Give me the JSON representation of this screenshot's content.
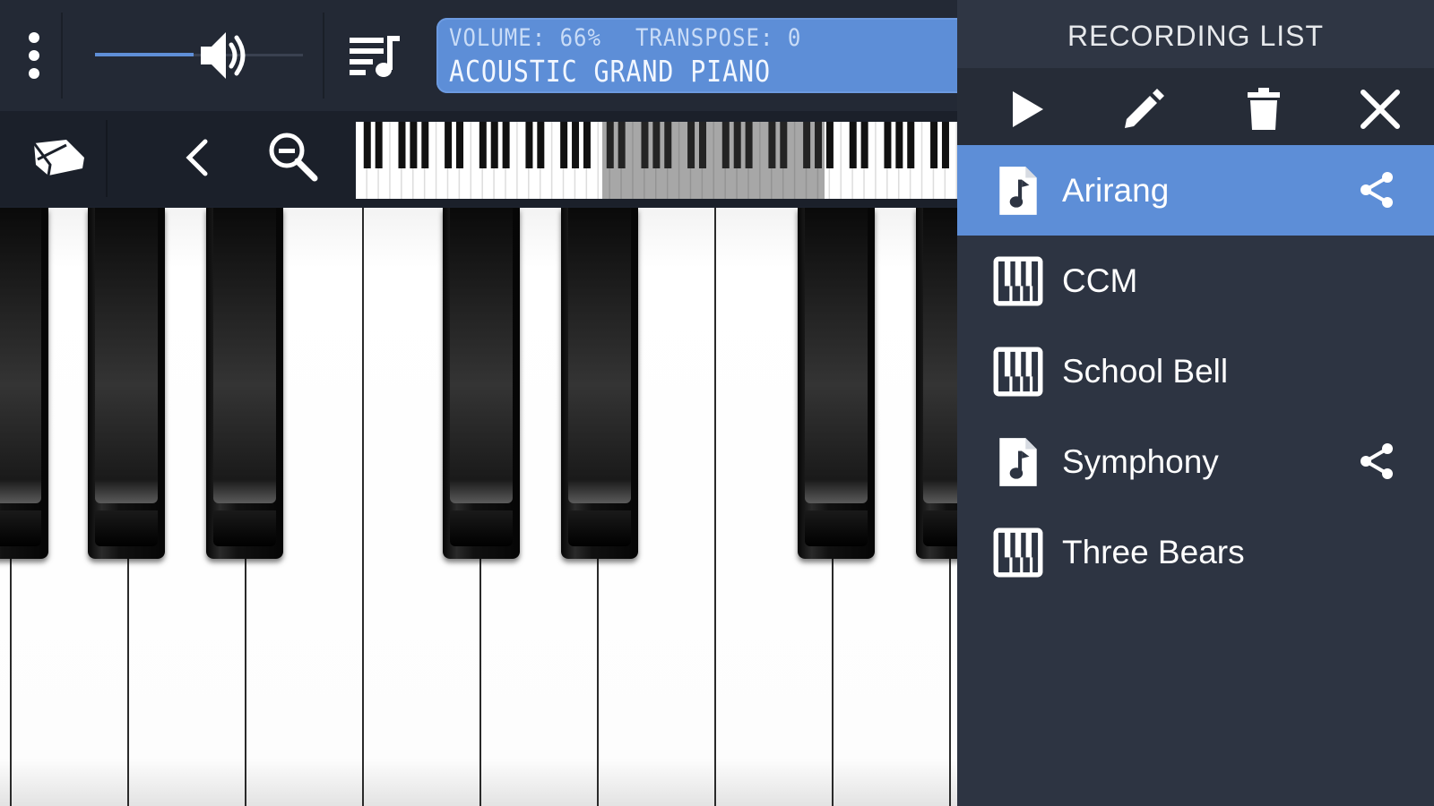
{
  "display": {
    "volume_text": "VOLUME: 66%",
    "transpose_text": "TRANSPOSE: 0",
    "instrument": "ACOUSTIC GRAND PIANO"
  },
  "volume": {
    "level_percent": 66
  },
  "keyboard_overview": {
    "visible_range_start_fraction": 0.41,
    "visible_range_end_fraction": 0.78
  },
  "icons": {
    "menu": "more-vertical-icon",
    "volume": "speaker-icon",
    "playlist": "playlist-music-icon",
    "sustain": "sustain-pedal-icon",
    "prev": "chevron-left-icon",
    "zoom": "zoom-out-icon",
    "play": "play-icon",
    "edit": "pencil-icon",
    "delete": "trash-icon",
    "close": "close-icon",
    "share": "share-icon"
  },
  "panel": {
    "title": "RECORDING LIST",
    "recordings": [
      {
        "label": "Arirang",
        "icon": "music-file-icon",
        "shareable": true,
        "selected": true
      },
      {
        "label": "CCM",
        "icon": "piano-keys-icon",
        "shareable": false,
        "selected": false
      },
      {
        "label": "School Bell",
        "icon": "piano-keys-icon",
        "shareable": false,
        "selected": false
      },
      {
        "label": "Symphony",
        "icon": "music-file-icon",
        "shareable": true,
        "selected": false
      },
      {
        "label": "Three Bears",
        "icon": "piano-keys-icon",
        "shareable": false,
        "selected": false
      }
    ]
  },
  "colors": {
    "accent": "#5d8ed7",
    "panel_bg": "#2d3442",
    "toolbar_bg": "#232935",
    "text": "#ffffff"
  }
}
